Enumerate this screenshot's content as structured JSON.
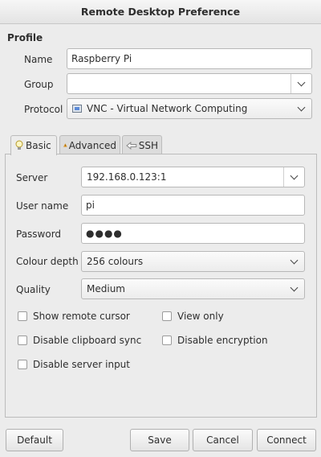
{
  "window": {
    "title": "Remote Desktop Preference"
  },
  "profile": {
    "section_title": "Profile",
    "name_label": "Name",
    "name_value": "Raspberry Pi",
    "group_label": "Group",
    "group_value": "",
    "protocol_label": "Protocol",
    "protocol_value": "VNC - Virtual Network Computing",
    "protocol_icon": "vnc-icon"
  },
  "tabs": [
    {
      "label": "Basic",
      "icon": "bulb-icon",
      "active": true
    },
    {
      "label": "Advanced",
      "icon": "warning-icon",
      "active": false
    },
    {
      "label": "SSH",
      "icon": "ssh-icon",
      "active": false
    }
  ],
  "basic": {
    "server_label": "Server",
    "server_value": "192.168.0.123:1",
    "username_label": "User name",
    "username_value": "pi",
    "password_label": "Password",
    "password_value": "●●●●",
    "colour_label": "Colour depth",
    "colour_value": "256 colours",
    "quality_label": "Quality",
    "quality_value": "Medium",
    "checkboxes": [
      {
        "label": "Show remote cursor",
        "checked": false
      },
      {
        "label": "View only",
        "checked": false
      },
      {
        "label": "Disable clipboard sync",
        "checked": false
      },
      {
        "label": "Disable encryption",
        "checked": false
      },
      {
        "label": "Disable server input",
        "checked": false
      }
    ]
  },
  "buttons": {
    "default": "Default",
    "save": "Save",
    "cancel": "Cancel",
    "connect": "Connect"
  }
}
